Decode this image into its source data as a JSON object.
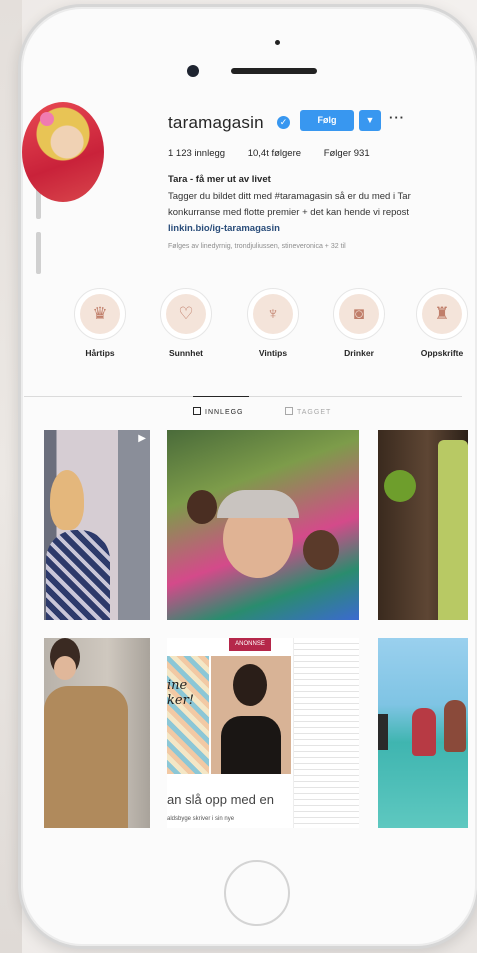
{
  "profile": {
    "username": "taramagasin",
    "verified_icon": "verified-badge-icon",
    "follow_label": "Følg",
    "dropdown_icon": "chevron-down-icon",
    "more_icon": "more-options-icon",
    "posts": "1 123 innlegg",
    "followers": "10,4t følgere",
    "following": "Følger 931",
    "bio_name": "Tara - få mer ut av livet",
    "bio_line1": "Tagger du bildet ditt med #taramagasin så er du med i Tar",
    "bio_line2": "konkurranse med flotte premier + det kan hende vi repost",
    "bio_link": "linkin.bio/ig-taramagasin",
    "followed_by": "Følges av linedyrnig, trondjuliussen, stineveronica + 32 til"
  },
  "highlights": [
    {
      "label": "Hårtips",
      "icon": "hair-icon"
    },
    {
      "label": "Sunnhet",
      "icon": "heart-icon"
    },
    {
      "label": "Vintips",
      "icon": "wine-glass-icon"
    },
    {
      "label": "Drinker",
      "icon": "drink-icon"
    },
    {
      "label": "Oppskrifte",
      "icon": "mixer-icon"
    }
  ],
  "tabs": [
    {
      "label": "INNLEGG",
      "icon": "grid-icon",
      "active": true
    },
    {
      "label": "TAGGET",
      "icon": "tag-icon",
      "active": false
    }
  ],
  "posts": {
    "overlay_text": "an slå opp med en",
    "overlay_text2": "aldsbyge skriver i sin nye",
    "script_text": "ine\nker!",
    "tag_label": "ANONNSE"
  },
  "colors": {
    "accent": "#3897f0",
    "background": "#fbfbfb"
  }
}
